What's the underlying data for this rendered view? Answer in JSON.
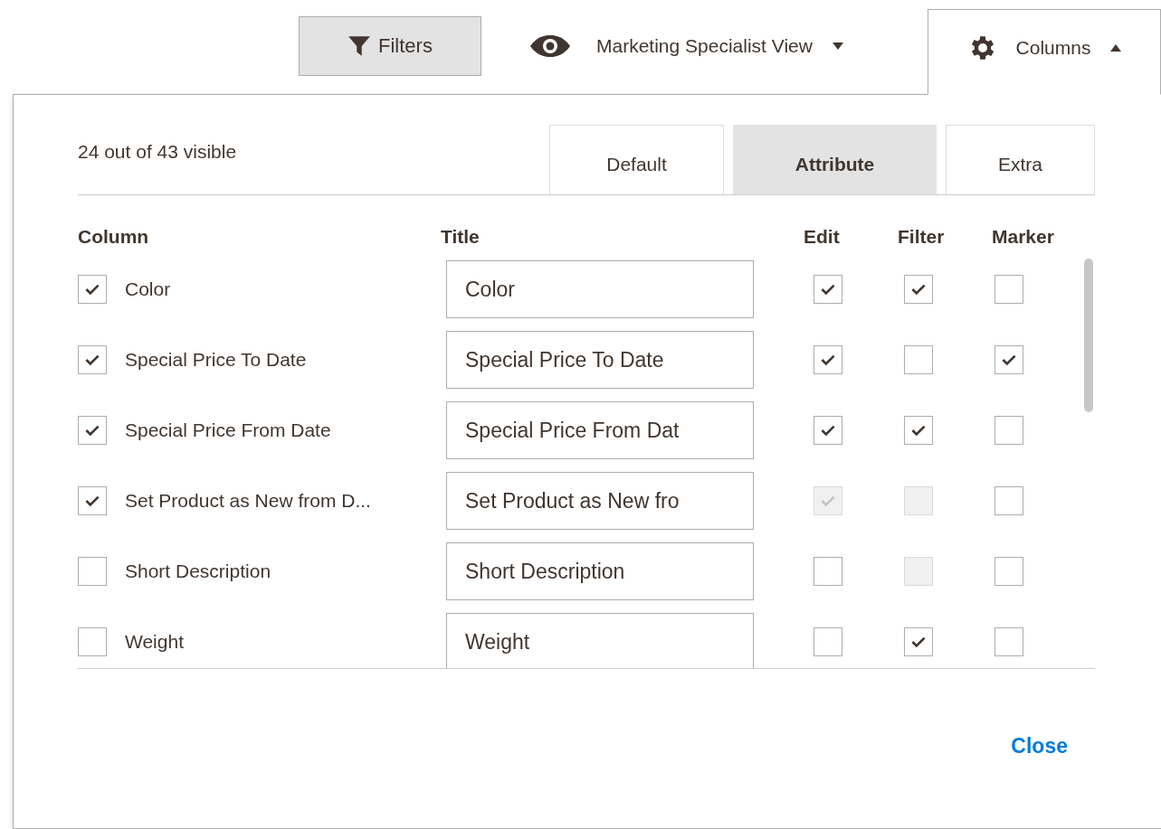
{
  "toolbar": {
    "filters_button": "Filters",
    "view_switcher": {
      "label": "Marketing Specialist View",
      "expanded": false
    },
    "columns_button": {
      "label": "Columns",
      "expanded": true
    }
  },
  "panel": {
    "visible_count": "24 out of 43 visible",
    "tabs": [
      {
        "label": "Default",
        "selected": false
      },
      {
        "label": "Attribute",
        "selected": true
      },
      {
        "label": "Extra",
        "selected": false
      }
    ],
    "headers": [
      "Column",
      "Title",
      "Edit",
      "Filter",
      "Marker"
    ],
    "rows": [
      {
        "visible": true,
        "label": "Color",
        "title": "Color",
        "edit": {
          "checked": true,
          "disabled": false
        },
        "filter": {
          "checked": true,
          "disabled": false
        },
        "marker": {
          "checked": false,
          "disabled": false
        }
      },
      {
        "visible": true,
        "label": "Special Price To Date",
        "title": "Special Price To Date",
        "edit": {
          "checked": true,
          "disabled": false
        },
        "filter": {
          "checked": false,
          "disabled": false
        },
        "marker": {
          "checked": true,
          "disabled": false
        }
      },
      {
        "visible": true,
        "label": "Special Price From Date",
        "title": "Special Price From Dat",
        "edit": {
          "checked": true,
          "disabled": false
        },
        "filter": {
          "checked": true,
          "disabled": false
        },
        "marker": {
          "checked": false,
          "disabled": false
        }
      },
      {
        "visible": true,
        "label": "Set Product as New from D...",
        "title": "Set Product as New fro",
        "edit": {
          "checked": true,
          "disabled": true
        },
        "filter": {
          "checked": false,
          "disabled": true
        },
        "marker": {
          "checked": false,
          "disabled": false
        }
      },
      {
        "visible": false,
        "label": "Short Description",
        "title": "Short Description",
        "edit": {
          "checked": false,
          "disabled": false
        },
        "filter": {
          "checked": false,
          "disabled": true
        },
        "marker": {
          "checked": false,
          "disabled": false
        }
      },
      {
        "visible": false,
        "label": "Weight",
        "title": "Weight",
        "edit": {
          "checked": false,
          "disabled": false
        },
        "filter": {
          "checked": true,
          "disabled": false
        },
        "marker": {
          "checked": false,
          "disabled": false
        }
      }
    ],
    "close": "Close"
  }
}
